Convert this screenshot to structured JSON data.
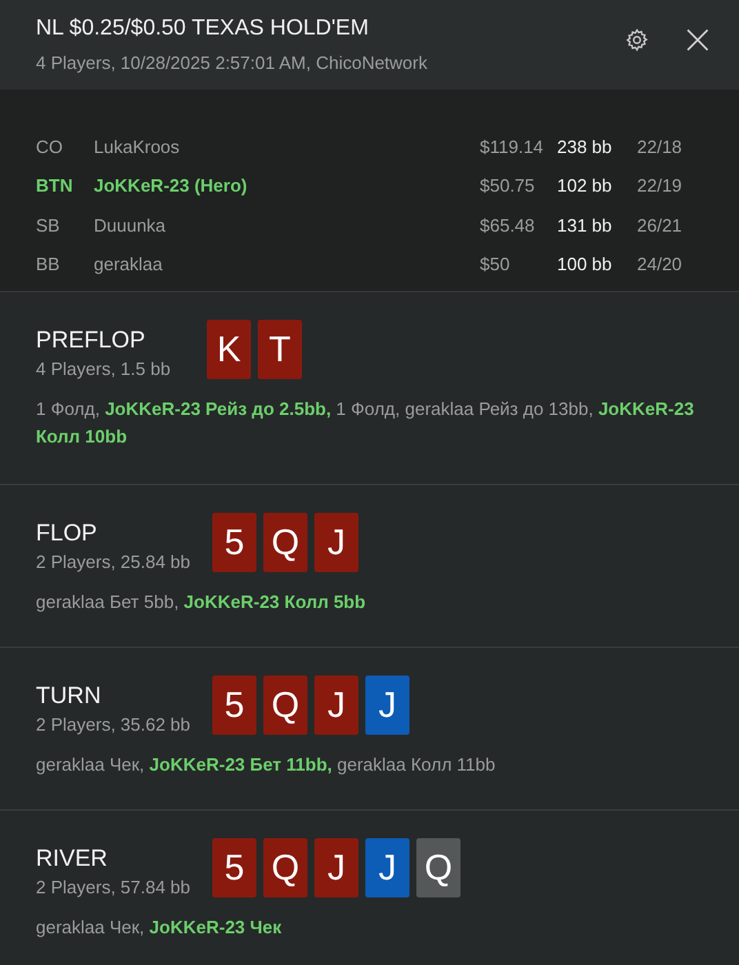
{
  "header": {
    "title": "NL $0.25/$0.50 TEXAS HOLD'EM",
    "subtitle": "4 Players, 10/28/2025 2:57:01 AM, ChicoNetwork"
  },
  "players": [
    {
      "position": "CO",
      "name": "LukaKroos",
      "stack": "$119.14",
      "bb": "238 bb",
      "stat": "22/18",
      "hero": false
    },
    {
      "position": "BTN",
      "name": "JoKKeR-23 (Hero)",
      "stack": "$50.75",
      "bb": "102 bb",
      "stat": "22/19",
      "hero": true
    },
    {
      "position": "SB",
      "name": "Duuunka",
      "stack": "$65.48",
      "bb": "131 bb",
      "stat": "26/21",
      "hero": false
    },
    {
      "position": "BB",
      "name": "geraklaa",
      "stack": "$50",
      "bb": "100 bb",
      "stat": "24/20",
      "hero": false
    }
  ],
  "streets": [
    {
      "name": "PREFLOP",
      "info": "4 Players, 1.5 bb",
      "cards": [
        {
          "rank": "K",
          "color": "#8b1a0e"
        },
        {
          "rank": "T",
          "color": "#8b1a0e"
        }
      ],
      "actions": [
        {
          "text": "1 Фолд, ",
          "hero": false
        },
        {
          "text": "JoKKeR-23 Рейз до 2.5bb,",
          "hero": true
        },
        {
          "text": " 1 Фолд, geraklaa Рейз до 13bb, ",
          "hero": false
        },
        {
          "text": "JoKKeR-23 Колл 10bb",
          "hero": true
        }
      ]
    },
    {
      "name": "FLOP",
      "info": "2 Players, 25.84 bb",
      "cards": [
        {
          "rank": "5",
          "color": "#8b1a0e"
        },
        {
          "rank": "Q",
          "color": "#8b1a0e"
        },
        {
          "rank": "J",
          "color": "#8b1a0e"
        }
      ],
      "actions": [
        {
          "text": "geraklaa Бет 5bb, ",
          "hero": false
        },
        {
          "text": "JoKKeR-23 Колл 5bb",
          "hero": true
        }
      ]
    },
    {
      "name": "TURN",
      "info": "2 Players, 35.62 bb",
      "cards": [
        {
          "rank": "5",
          "color": "#8b1a0e"
        },
        {
          "rank": "Q",
          "color": "#8b1a0e"
        },
        {
          "rank": "J",
          "color": "#8b1a0e"
        },
        {
          "rank": "J",
          "color": "#0d5cb6"
        }
      ],
      "actions": [
        {
          "text": "geraklaa Чек, ",
          "hero": false
        },
        {
          "text": "JoKKeR-23 Бет 11bb,",
          "hero": true
        },
        {
          "text": " geraklaa Колл 11bb",
          "hero": false
        }
      ]
    },
    {
      "name": "RIVER",
      "info": "2 Players, 57.84 bb",
      "cards": [
        {
          "rank": "5",
          "color": "#8b1a0e"
        },
        {
          "rank": "Q",
          "color": "#8b1a0e"
        },
        {
          "rank": "J",
          "color": "#8b1a0e"
        },
        {
          "rank": "J",
          "color": "#0d5cb6"
        },
        {
          "rank": "Q",
          "color": "#555858"
        }
      ],
      "actions": [
        {
          "text": "geraklaa Чек, ",
          "hero": false
        },
        {
          "text": "JoKKeR-23 Чек",
          "hero": true
        }
      ]
    }
  ]
}
